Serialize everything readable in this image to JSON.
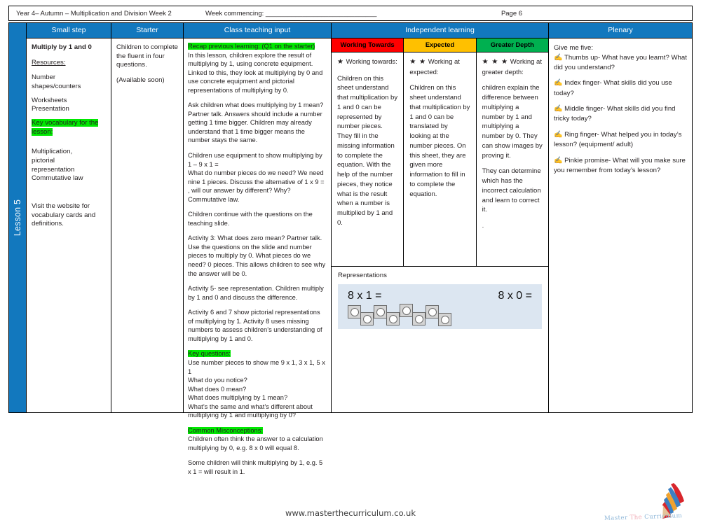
{
  "topbar": {
    "plan_title": "Year 4– Autumn – Multiplication and Division Week 2",
    "week_commencing_label": "Week commencing: ______________________________",
    "page_label": "Page 6"
  },
  "lesson_band": {
    "label": "Lesson 5"
  },
  "columns": {
    "small_step": {
      "header": "Small step",
      "title": "Multiply by 1 and 0",
      "resources_label": "Resources:",
      "resources": [
        "Number shapes/counters",
        "Worksheets Presentation"
      ],
      "key_vocab_label": "Key vocabulary for the lesson:",
      "vocab": [
        "Multiplication,",
        "pictorial",
        "representation",
        "Commutative law"
      ],
      "website_note": "Visit the website for vocabulary cards and definitions."
    },
    "starter": {
      "header": "Starter",
      "body": "Children to complete the fluent in four questions.",
      "availability": "(Available soon)"
    },
    "class_teaching_input": {
      "header": "Class teaching input",
      "recap_label": "Recap previous learning: (Q1 on the starter)",
      "recap_text": "In this lesson, children explore the result of multiplying by 1,    using concrete equipment. Linked to this, they look at multiplying by 0 and use concrete equipment and pictorial representations of multiplying  by 0.",
      "p2": "Ask children what does multiplying by 1 mean?\nPartner talk. Answers should include a number getting 1 time bigger. Children may already understand that 1 time bigger means the number stays the same.",
      "p3": "Children use equipment to show multiplying by 1 – 9 x 1 =\nWhat do number pieces do we need? We need nine 1 pieces. Discuss  the alternative of 1 x 9 = , will our answer by different? Why? Commutative law.",
      "p4": "Children continue with the questions on the teaching slide.",
      "p5": "Activity 3: What does zero mean? Partner talk. Use the questions on the slide and number pieces to multiply by 0. What pieces do we need? 0 pieces. This allows children to see why the answer will be 0.",
      "p6": "Activity 5- see representation. Children multiply by 1 and 0 and discuss the difference.",
      "p7": "Activity 6 and 7 show pictorial representations of multiplying by 1. Activity 8 uses missing numbers to assess children’s understanding of multiplying by 1 and 0.",
      "key_questions_label": "Key questions:",
      "key_questions": "Use number pieces to show me 9 x 1, 3 x 1, 5 x 1\nWhat do you notice?\nWhat does 0 mean?\nWhat does multiplying by 1 mean?\nWhat’s the same and what’s different about multiplying by 1 and multiplying by 0?",
      "misconceptions_label": "Common Misconceptions:",
      "misconceptions": "Children often think the answer to a calculation multiplying by 0, e.g. 8 x 0 will equal 8.",
      "misconceptions2": "Some children will think multiplying by 1, e.g. 5 x 1 = will result in 1."
    },
    "independent_learning": {
      "header": "Independent learning",
      "levels": [
        {
          "name": "Working Towards",
          "color": "#ff0000",
          "stars": "★",
          "heading": "Working towards:",
          "text": "Children on this sheet understand that multiplication by 1 and 0 can be represented by number pieces. They fill in the missing information to complete the equation. With the help of the number pieces, they notice what is the result when a number is multiplied by 1 and 0."
        },
        {
          "name": "Expected",
          "color": "#ffc000",
          "stars": "★ ★",
          "heading": "Working at expected:",
          "text": "Children on this sheet understand that multiplication by 1 and 0 can be translated by looking at the number pieces. On this sheet, they are given more information to fill in to complete the equation."
        },
        {
          "name": "Greater Depth",
          "color": "#00b050",
          "stars": "★ ★ ★",
          "heading": "Working at greater depth:",
          "text": "children explain the difference between multiplying a number by 1 and multiplying a number by 0. They can show images by proving it.",
          "text2": "They can determine which has the incorrect calculation and learn to correct it.",
          "text3": "."
        }
      ],
      "representations_label": "Representations",
      "representation": {
        "equation_left": "8 x 1 =",
        "equation_right": "8 x 0 =",
        "counter_count": 8,
        "background": "#dce6f1"
      }
    },
    "plenary": {
      "header": "Plenary",
      "intro": "Give me five:",
      "items": [
        "Thumbs up- What have you learnt? What did you understand?",
        "Index finger- What skills did you use today?",
        "Middle finger- What skills did you find tricky today?",
        "Ring finger- What helped you in today’s lesson? (equipment/ adult)",
        "Pinkie promise- What will you make sure you remember from today’s lesson?"
      ],
      "hand_icon": "hand-icon"
    }
  },
  "footer": {
    "url": "www.masterthecurriculum.co.uk",
    "logo_word1": "Master",
    "logo_word2": "The",
    "logo_word3": "Curriculum"
  },
  "theme": {
    "header_blue": "#1278be",
    "highlight_green": "#00e800",
    "rep_blue": "#dce6f1"
  }
}
